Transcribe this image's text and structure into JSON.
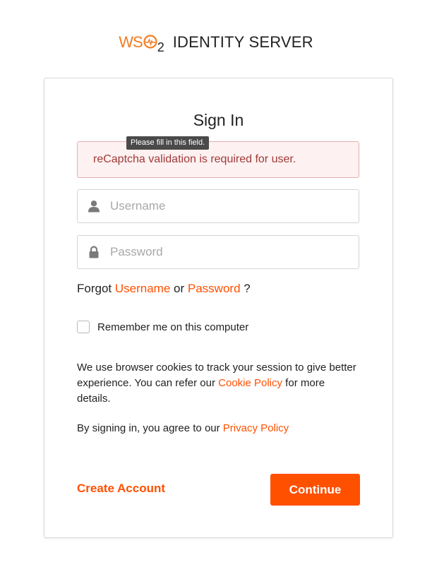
{
  "header": {
    "logo_text": "WSO2",
    "logo_ws": "WS",
    "logo_two": "2",
    "product_name": "IDENTITY SERVER"
  },
  "login": {
    "title": "Sign In",
    "tooltip": "Please fill in this field.",
    "error_message": "reCaptcha validation is required for user.",
    "username_placeholder": "Username",
    "username_value": "",
    "password_placeholder": "Password",
    "password_value": "",
    "forgot_prefix": "Forgot",
    "forgot_username": "Username",
    "forgot_or": "or",
    "forgot_password": "Password",
    "forgot_suffix": "?",
    "remember_label": "Remember me on this computer",
    "remember_checked": false,
    "cookie_text_before": "We use browser cookies to track your session to give better experience. You can refer our ",
    "cookie_link": "Cookie Policy",
    "cookie_text_after": " for more details.",
    "privacy_prefix": "By signing in, you agree to our ",
    "privacy_link": "Privacy Policy",
    "create_account": "Create Account",
    "continue_button": "Continue"
  },
  "colors": {
    "accent": "#ff5000",
    "logo_orange": "#f47b20",
    "error_bg": "#fdf1f1",
    "error_border": "#e4b1b1",
    "error_text": "#9f3a38"
  },
  "icons": {
    "username": "user-icon",
    "password": "lock-icon"
  }
}
